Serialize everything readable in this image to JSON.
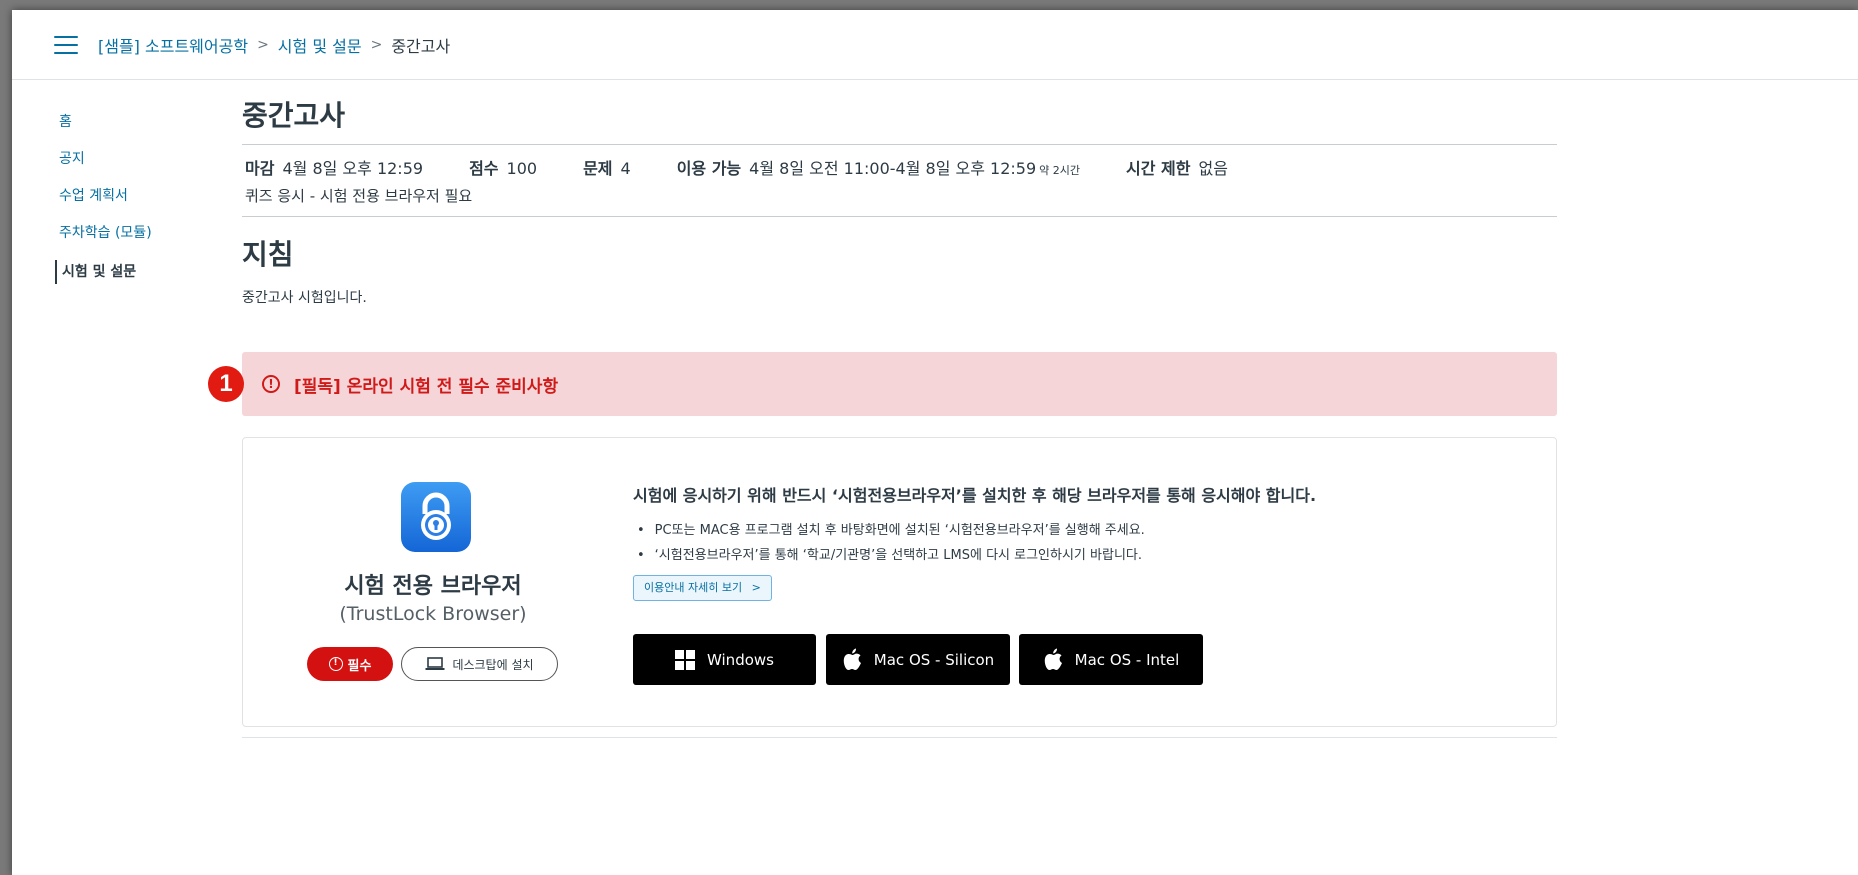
{
  "breadcrumb": {
    "course": "[샘플] 소프트웨어공학",
    "section": "시험 및 설문",
    "current": "중간고사",
    "separator": ">"
  },
  "sidebar": {
    "items": [
      {
        "label": "홈"
      },
      {
        "label": "공지"
      },
      {
        "label": "수업 계획서"
      },
      {
        "label": "주차학습 (모듈)"
      },
      {
        "label": "시험 및 설문"
      }
    ]
  },
  "quiz": {
    "title": "중간고사",
    "due_label": "마감",
    "due_value": "4월 8일 오후 12:59",
    "points_label": "점수",
    "points_value": "100",
    "questions_label": "문제",
    "questions_value": "4",
    "available_label": "이용 가능",
    "available_value": "4월 8일 오전 11:00-4월 8일 오후 12:59",
    "available_approx": "약 2시간",
    "time_limit_label": "시간 제한",
    "time_limit_value": "없음",
    "note": "퀴즈 응시 - 시험 전용 브라우저 필요"
  },
  "instructions": {
    "title": "지침",
    "text": "중간고사 시험입니다."
  },
  "alert": {
    "badge_number": "1",
    "icon_glyph": "!",
    "text": "[필독] 온라인 시험 전 필수 준비사항"
  },
  "browser_card": {
    "app_name": "시험 전용 브라우저",
    "app_subtitle": "(TrustLock Browser)",
    "required_label": "필수",
    "required_glyph": "!",
    "desktop_install_label": "데스크탑에 설치",
    "heading": "시험에 응시하기 위해 반드시 ‘시험전용브라우저’를 설치한 후 해당 브라우저를 통해 응시해야 합니다.",
    "bullets": [
      "PC또는 MAC용 프로그램 설치 후 바탕화면에 설치된 ‘시험전용브라우저’를 실행해 주세요.",
      "‘시험전용브라우저’를 통해 ‘학교/기관명’을 선택하고 LMS에 다시 로그인하시기 바랍니다."
    ],
    "guide_link": "이용안내 자세히 보기",
    "guide_chevron": ">",
    "downloads": [
      {
        "label": "Windows",
        "icon": "windows-icon"
      },
      {
        "label": "Mac OS - Silicon",
        "icon": "apple-icon"
      },
      {
        "label": "Mac OS - Intel",
        "icon": "apple-icon"
      }
    ]
  },
  "colors": {
    "link": "#0770a3",
    "text": "#2d3b45",
    "alert_bg": "#f6d5d8",
    "alert_text": "#d01a19",
    "required_bg": "#d41111",
    "download_bg": "#000000"
  }
}
